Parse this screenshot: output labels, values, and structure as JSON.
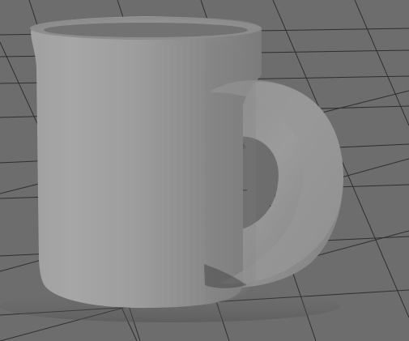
{
  "scene": {
    "object_name": "mug",
    "background_color": "#6d6d6d",
    "grid_color": "#2f2f2f",
    "mug_color": "#9b9b9b"
  }
}
